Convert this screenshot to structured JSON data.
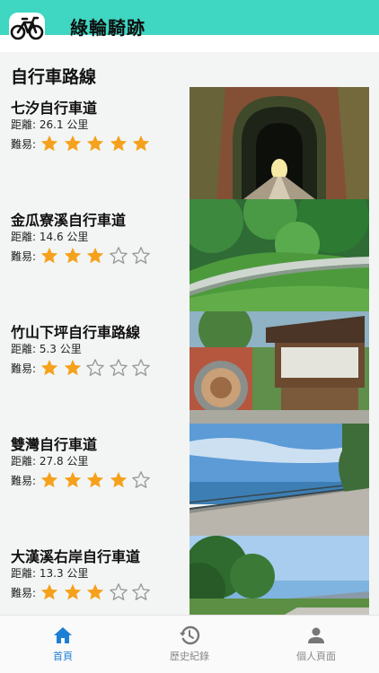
{
  "app": {
    "title": "綠輪騎跡"
  },
  "main": {
    "section_title": "自行車路線",
    "routes": [
      {
        "name": "七汐自行車道",
        "distance": "距離: 26.1 公里",
        "difficulty_label": "難易:",
        "rating": 5,
        "max_rating": 5,
        "photo": "tunnel-photo"
      },
      {
        "name": "金瓜寮溪自行車道",
        "distance": "距離: 14.6 公里",
        "difficulty_label": "難易:",
        "rating": 3,
        "max_rating": 5,
        "photo": "forest-boardwalk-photo"
      },
      {
        "name": "竹山下坪自行車路線",
        "distance": "距離: 5.3 公里",
        "difficulty_label": "難易:",
        "rating": 2,
        "max_rating": 5,
        "photo": "trail-sign-photo"
      },
      {
        "name": "雙灣自行車道",
        "distance": "距離: 27.8 公里",
        "difficulty_label": "難易:",
        "rating": 4,
        "max_rating": 5,
        "photo": "seaside-path-photo"
      },
      {
        "name": "大漢溪右岸自行車道",
        "distance": "距離: 13.3 公里",
        "difficulty_label": "難易:",
        "rating": 3,
        "max_rating": 5,
        "photo": "riverbank-photo"
      }
    ]
  },
  "tab_bar": {
    "tabs": [
      {
        "label": "首頁",
        "icon": "home-icon",
        "active": true
      },
      {
        "label": "歷史紀錄",
        "icon": "history-icon",
        "active": false
      },
      {
        "label": "個人頁面",
        "icon": "person-icon",
        "active": false
      }
    ]
  },
  "colors": {
    "header": "#3fd6c2",
    "star_filled": "#f5a11c",
    "star_empty": "#9a9a9a",
    "tab_active": "#1b7fd6",
    "tab_inactive": "#8a8a8a"
  }
}
